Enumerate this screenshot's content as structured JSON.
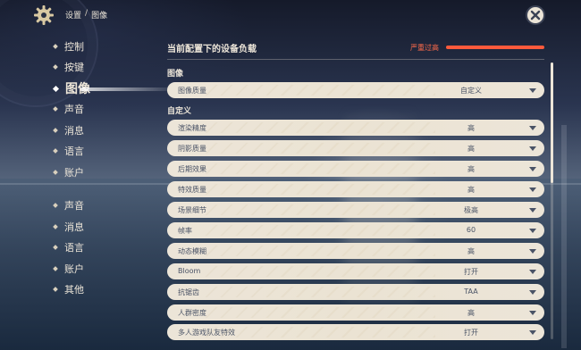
{
  "breadcrumb": {
    "root": "设置",
    "separator": "/",
    "current": "图像"
  },
  "icons": {
    "settings": "gear-icon",
    "close": "close-icon",
    "dropdown": "chevron-down-icon"
  },
  "sidebar": {
    "items": [
      {
        "label": "控制",
        "active": false
      },
      {
        "label": "按键",
        "active": false
      },
      {
        "label": "图像",
        "active": true
      },
      {
        "label": "声音",
        "active": false
      },
      {
        "label": "消息",
        "active": false
      },
      {
        "label": "语言",
        "active": false
      },
      {
        "label": "账户",
        "active": false
      },
      {
        "label": "声音",
        "active": false
      },
      {
        "label": "消息",
        "active": false
      },
      {
        "label": "语言",
        "active": false
      },
      {
        "label": "账户",
        "active": false
      },
      {
        "label": "其他",
        "active": false
      }
    ]
  },
  "device_load": {
    "label": "当前配置下的设备负载",
    "status": "严重过高",
    "level_percent": 100,
    "status_color": "#ff5a3c"
  },
  "sections": {
    "image": {
      "title": "图像",
      "rows": [
        {
          "label": "图像质量",
          "value": "自定义"
        }
      ]
    },
    "custom": {
      "title": "自定义",
      "rows": [
        {
          "label": "渲染精度",
          "value": "高"
        },
        {
          "label": "阴影质量",
          "value": "高"
        },
        {
          "label": "后期效果",
          "value": "高"
        },
        {
          "label": "特效质量",
          "value": "高"
        },
        {
          "label": "场景细节",
          "value": "极高"
        },
        {
          "label": "帧率",
          "value": "60"
        },
        {
          "label": "动态模糊",
          "value": "高"
        },
        {
          "label": "Bloom",
          "value": "打开"
        },
        {
          "label": "抗锯齿",
          "value": "TAA"
        },
        {
          "label": "人群密度",
          "value": "高"
        },
        {
          "label": "多人游戏队友特效",
          "value": "打开"
        }
      ]
    }
  },
  "colors": {
    "panel_cream": "#ece5d8",
    "text_dark": "#4a5366",
    "accent_red": "#ff5a3c"
  }
}
